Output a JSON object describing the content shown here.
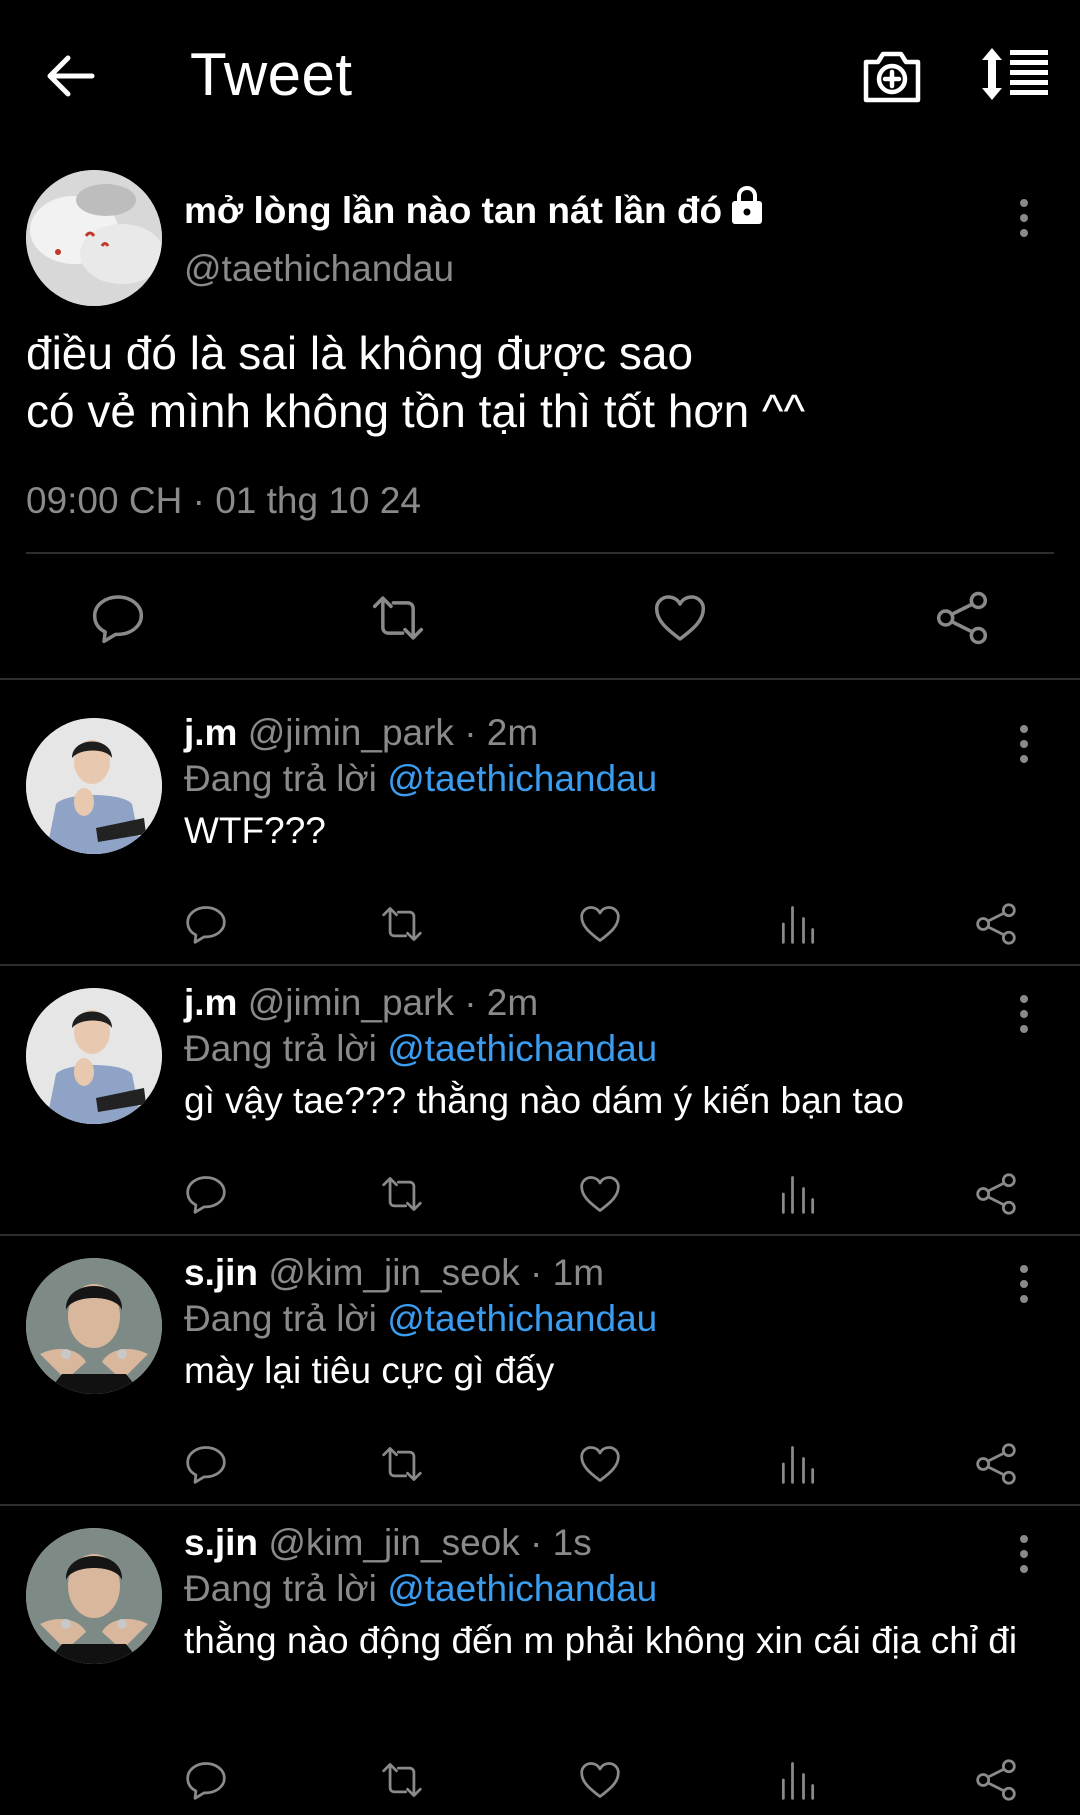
{
  "header": {
    "title": "Tweet",
    "back_icon": "arrow-left-icon",
    "camera_icon": "camera-plus-icon",
    "sort_icon": "sort-icon"
  },
  "main_tweet": {
    "display_name": "mở lòng lần nào tan nát lần đó",
    "protected_icon": "lock-icon",
    "handle": "@taethichandau",
    "text": "điều đó là sai là không được sao\ncó vẻ mình không tồn tại thì tốt hơn ^^",
    "timestamp": "09:00 CH · 01 thg 10 24",
    "actions": [
      "reply-icon",
      "retweet-icon",
      "like-icon",
      "share-icon"
    ]
  },
  "replies": [
    {
      "name": "j.m",
      "meta": "@jimin_park · 2m",
      "replying_label": "Đang trả lời",
      "replying_to": "@taethichandau",
      "text": "WTF???"
    },
    {
      "name": "j.m",
      "meta": "@jimin_park · 2m",
      "replying_label": "Đang trả lời",
      "replying_to": "@taethichandau",
      "text": "gì vậy tae??? thằng nào dám ý kiến bạn tao"
    },
    {
      "name": "s.jin",
      "meta": "@kim_jin_seok · 1m",
      "replying_label": "Đang trả lời",
      "replying_to": "@taethichandau",
      "text": "mày lại tiêu cực gì đấy"
    },
    {
      "name": "s.jin",
      "meta": "@kim_jin_seok · 1s",
      "replying_label": "Đang trả lời",
      "replying_to": "@taethichandau",
      "text": "thằng nào động đến m phải không xin cái địa chỉ đi"
    }
  ],
  "colors": {
    "background": "#000000",
    "text": "#ffffff",
    "secondary": "#8a8a8a",
    "link": "#3b9df0",
    "divider": "#2e2e2e"
  }
}
